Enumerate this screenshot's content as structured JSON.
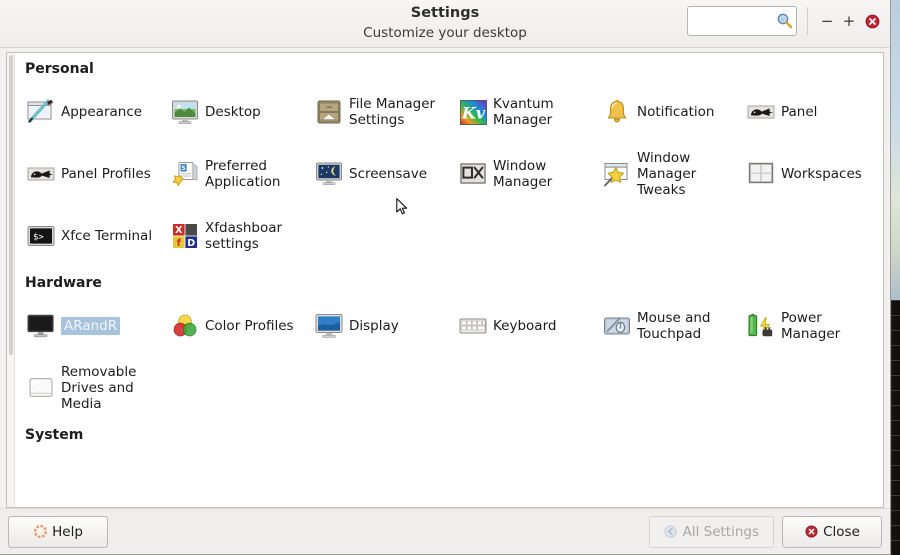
{
  "window": {
    "title": "Settings",
    "subtitle": "Customize your desktop",
    "search_placeholder": "",
    "search_value": "",
    "search_icon": "search-icon",
    "minimize_label": "−",
    "maximize_label": "+",
    "close_icon": "window-close-icon"
  },
  "groups": [
    {
      "title": "Personal",
      "items": [
        {
          "label": "Appearance",
          "icon": "appearance-icon",
          "selected": false
        },
        {
          "label": "Desktop",
          "icon": "desktop-icon",
          "selected": false
        },
        {
          "label": "File Manager Settings",
          "icon": "file-manager-icon",
          "selected": false
        },
        {
          "label": "Kvantum Manager",
          "icon": "kvantum-manager-icon",
          "selected": false
        },
        {
          "label": "Notification",
          "icon": "notification-bell-icon",
          "selected": false
        },
        {
          "label": "Panel",
          "icon": "panel-icon",
          "selected": false
        },
        {
          "label": "Panel Profiles",
          "icon": "panel-profiles-icon",
          "selected": false
        },
        {
          "label": "Preferred Application",
          "icon": "preferred-applications-icon",
          "selected": false
        },
        {
          "label": "Screensave",
          "icon": "screensaver-icon",
          "selected": false
        },
        {
          "label": "Window Manager",
          "icon": "window-manager-icon",
          "selected": false
        },
        {
          "label": "Window Manager Tweaks",
          "icon": "window-manager-tweaks-icon",
          "selected": false
        },
        {
          "label": "Workspaces",
          "icon": "workspaces-icon",
          "selected": false
        },
        {
          "label": "Xfce Terminal",
          "icon": "xfce-terminal-icon",
          "selected": false
        },
        {
          "label": "Xfdashboar settings",
          "icon": "xfdashboard-icon",
          "selected": false
        }
      ]
    },
    {
      "title": "Hardware",
      "items": [
        {
          "label": "ARandR",
          "icon": "arandr-monitor-icon",
          "selected": true
        },
        {
          "label": "Color Profiles",
          "icon": "color-profiles-icon",
          "selected": false
        },
        {
          "label": "Display",
          "icon": "display-icon",
          "selected": false
        },
        {
          "label": "Keyboard",
          "icon": "keyboard-icon",
          "selected": false
        },
        {
          "label": "Mouse and Touchpad",
          "icon": "mouse-touchpad-icon",
          "selected": false
        },
        {
          "label": "Power Manager",
          "icon": "power-manager-icon",
          "selected": false
        },
        {
          "label": "Removable Drives and Media",
          "icon": "removable-drives-icon",
          "selected": false
        }
      ]
    },
    {
      "title": "System",
      "items": []
    }
  ],
  "buttons": {
    "help": {
      "label": "Help",
      "icon": "help-icon",
      "disabled": false
    },
    "all_settings": {
      "label": "All Settings",
      "icon": "back-arrow-icon",
      "disabled": true
    },
    "close": {
      "label": "Close",
      "icon": "close-circle-icon",
      "disabled": false
    }
  },
  "colors": {
    "selection": "#a7c3dd",
    "close_red": "#c1272d",
    "help_orange": "#e8a87c",
    "window_bg": "#f2f1f0"
  }
}
